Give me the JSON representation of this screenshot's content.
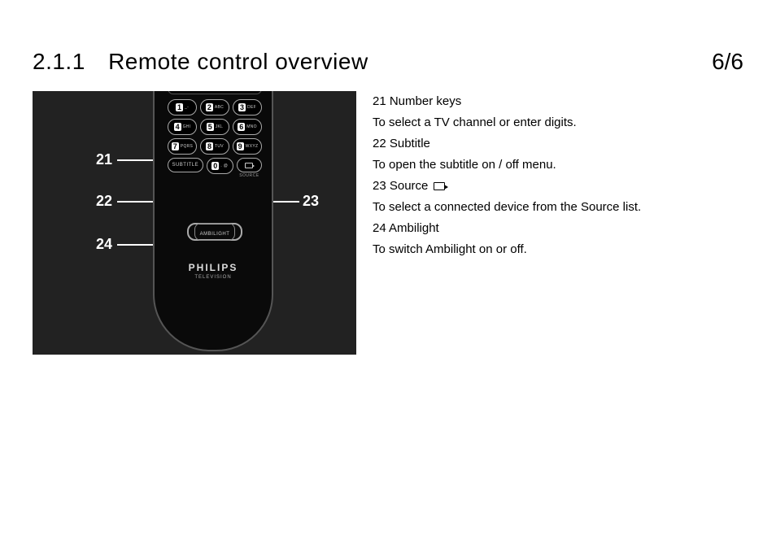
{
  "header": {
    "section_number": "2.1.1",
    "title": "Remote control overview",
    "page": "6/6"
  },
  "callouts": {
    "c21": "21",
    "c22": "22",
    "c23": "23",
    "c24": "24"
  },
  "remote": {
    "keys": [
      {
        "num": "1",
        "sub": "_-"
      },
      {
        "num": "2",
        "sub": "ABC"
      },
      {
        "num": "3",
        "sub": "DEF"
      },
      {
        "num": "4",
        "sub": "GHI"
      },
      {
        "num": "5",
        "sub": "JKL"
      },
      {
        "num": "6",
        "sub": "MNO"
      },
      {
        "num": "7",
        "sub": "PQRS"
      },
      {
        "num": "8",
        "sub": "TUV"
      },
      {
        "num": "9",
        "sub": "WXYZ"
      }
    ],
    "row4": {
      "subtitle": "SUBTITLE",
      "zero_num": "0",
      "zero_sub": ". @",
      "source_label": "SOURCE"
    },
    "ambilight": "AMBILIGHT",
    "brand": "PHILIPS",
    "brand_sub": "TELEVISION"
  },
  "desc": {
    "l1": "21 Number keys",
    "l2": "To select a TV channel or enter digits.",
    "l3": "22 Subtitle",
    "l4": "To open the subtitle on / off menu.",
    "l5": "23 Source ",
    "l6": "To select a connected device from the Source list.",
    "l7": "24 Ambilight",
    "l8": "To switch Ambilight on or off."
  }
}
